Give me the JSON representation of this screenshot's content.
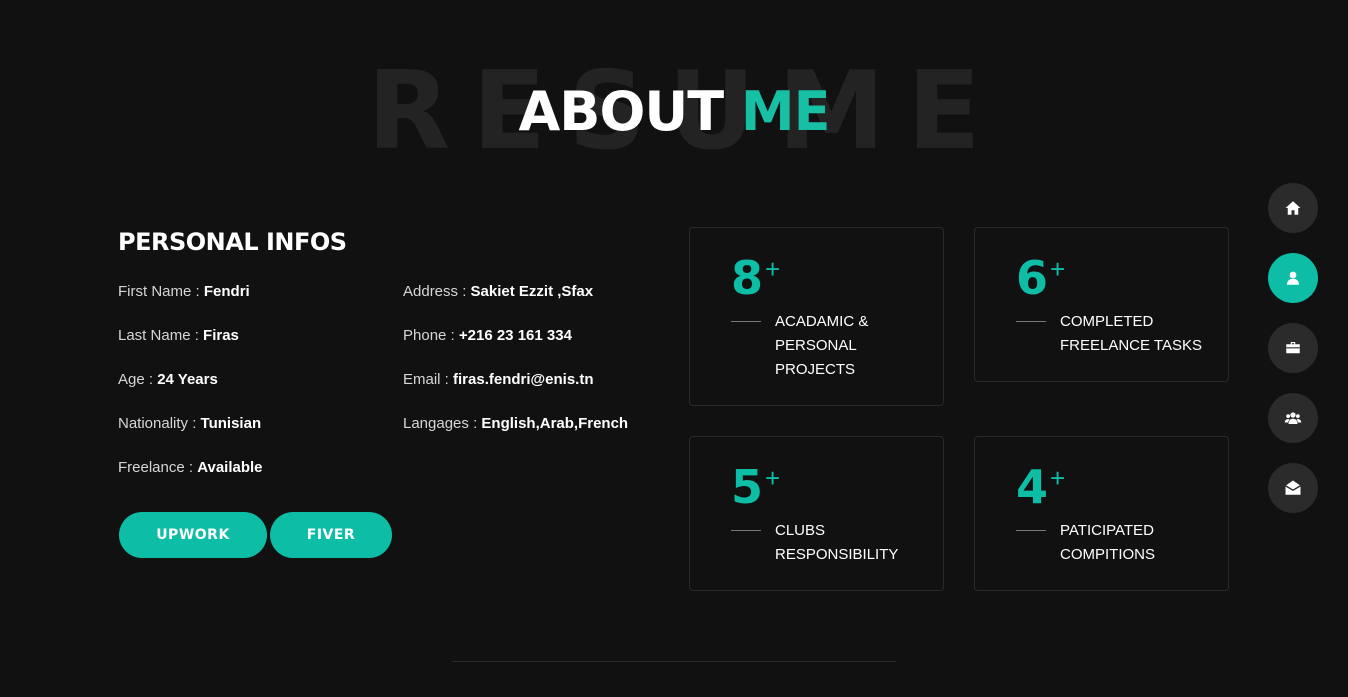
{
  "section": {
    "bg_word": "RESUME",
    "title_main": "ABOUT",
    "title_accent": "ME"
  },
  "personal": {
    "heading": "PERSONAL INFOS",
    "left": [
      {
        "label": "First Name :",
        "value": "Fendri"
      },
      {
        "label": "Last Name :",
        "value": "Firas"
      },
      {
        "label": "Age :",
        "value": "24 Years"
      },
      {
        "label": "Nationality :",
        "value": "Tunisian"
      },
      {
        "label": "Freelance :",
        "value": "Available"
      }
    ],
    "right": [
      {
        "label": "Address :",
        "value": "Sakiet Ezzit ,Sfax"
      },
      {
        "label": "Phone :",
        "value": "+216 23 161 334"
      },
      {
        "label": "Email :",
        "value": "firas.fendri@enis.tn"
      },
      {
        "label": "Langages :",
        "value": "English,Arab,French"
      }
    ],
    "buttons": {
      "upwork": "UPWORK",
      "fiver": "FIVER"
    }
  },
  "stats": [
    {
      "number": "8",
      "plus": "+",
      "label_lines": [
        "ACADAMIC &",
        "PERSONAL",
        "PROJECTS"
      ]
    },
    {
      "number": "6",
      "plus": "+",
      "label_lines": [
        "COMPLETED",
        "FREELANCE TASKS"
      ]
    },
    {
      "number": "5",
      "plus": "+",
      "label_lines": [
        "CLUBS",
        "RESPONSIBILITY"
      ]
    },
    {
      "number": "4",
      "plus": "+",
      "label_lines": [
        "PATICIPATED",
        "COMPITIONS"
      ]
    }
  ],
  "nav": [
    {
      "icon": "home-icon",
      "active": false
    },
    {
      "icon": "user-icon",
      "active": true
    },
    {
      "icon": "briefcase-icon",
      "active": false
    },
    {
      "icon": "users-icon",
      "active": false
    },
    {
      "icon": "envelope-open-icon",
      "active": false
    }
  ],
  "colors": {
    "accent": "#0dbda5",
    "background": "#111111"
  }
}
